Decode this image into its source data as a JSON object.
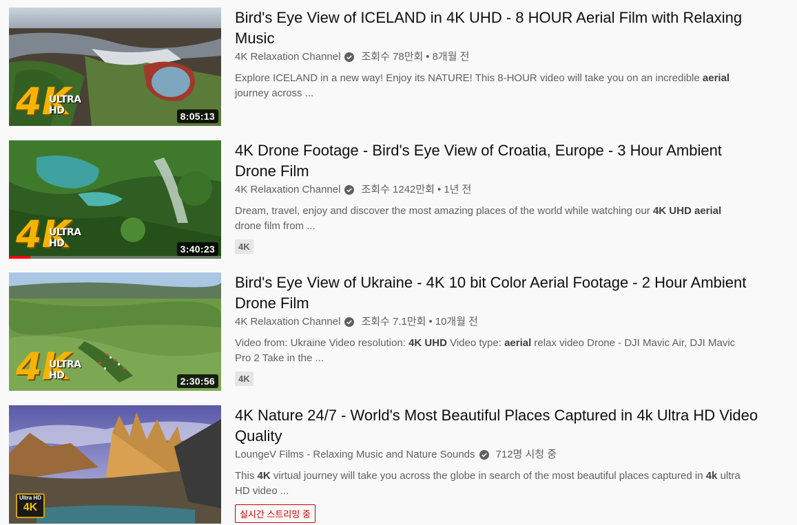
{
  "results": [
    {
      "title": "Bird's Eye View of ICELAND in 4K UHD - 8 HOUR Aerial Film with Relaxing Music",
      "channel": "4K Relaxation Channel",
      "views": "조회수 78만회",
      "age": "8개월 전",
      "duration": "8:05:13",
      "thumb_badge_big": "4K",
      "thumb_badge_small": "ULTRA HD",
      "desc_parts": [
        "Explore ICELAND in a new way! Enjoy its NATURE! This 8-HOUR video will take you on an incredible ",
        "aerial",
        " journey across ..."
      ]
    },
    {
      "title": "4K Drone Footage - Bird's Eye View of Croatia, Europe - 3 Hour Ambient Drone Film",
      "channel": "4K Relaxation Channel",
      "views": "조회수 1242만회",
      "age": "1년 전",
      "duration": "3:40:23",
      "thumb_badge_big": "4K",
      "thumb_badge_small": "ULTRA HD",
      "watch_progress": 0.1,
      "desc_parts": [
        "Dream, travel, enjoy and discover the most amazing places of the world while watching our ",
        "4K UHD",
        " ",
        "aerial",
        " drone film from ..."
      ],
      "tag": "4K"
    },
    {
      "title": "Bird's Eye View of Ukraine - 4K 10 bit Color Aerial Footage - 2 Hour Ambient Drone Film",
      "channel": "4K Relaxation Channel",
      "views": "조회수 7.1만회",
      "age": "10개월 전",
      "duration": "2:30:56",
      "thumb_badge_big": "4K",
      "thumb_badge_small": "ULTRA HD",
      "desc_parts": [
        "Video from: Ukraine Video resolution: ",
        "4K UHD",
        " Video type: ",
        "aerial",
        " relax video Drone - DJI Mavic Air, DJI Mavic Pro 2 Take in the ..."
      ],
      "tag": "4K"
    },
    {
      "title": "4K Nature 24/7 - World's Most Beautiful Places Captured in 4k Ultra HD Video Quality",
      "channel": "LoungeV Films - Relaxing Music and Nature Sounds",
      "watching": "712명 시청 중",
      "thumb_badge_small": "Ultra HD",
      "thumb_badge_big": "4K",
      "desc_parts": [
        "This ",
        "4K",
        " virtual journey will take you across the globe in search of the most beautiful places captured in ",
        "4k",
        " ultra HD video ..."
      ],
      "live_label": "실시간 스트리밍 중"
    }
  ],
  "colors": {
    "accent_red": "#ff0000",
    "live_red": "#cc0000",
    "meta_gray": "#606060"
  },
  "icons": {
    "verified": "verified-check-icon"
  }
}
